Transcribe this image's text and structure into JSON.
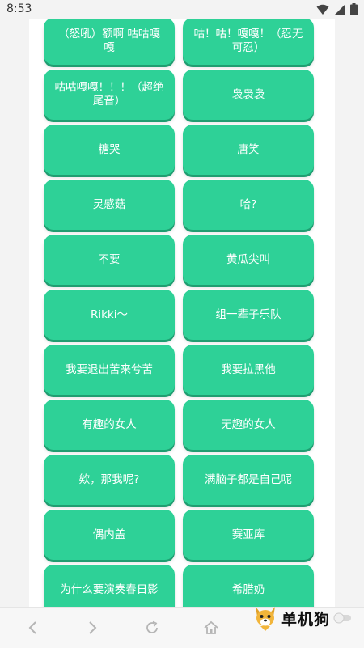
{
  "status_bar": {
    "time": "8:53"
  },
  "sound_buttons": [
    "（怒吼）额啊 咕咕嘎嘎",
    "咕！咕！嘎嘎！（忍无可忍）",
    "咕咕嘎嘎！！！（超绝尾音）",
    "袅袅袅",
    "糖哭",
    "唐笑",
    "灵感菇",
    "哈?",
    "不要",
    "黄瓜尖叫",
    "Rikki～",
    "组一辈子乐队",
    "我要退出苦来兮苦",
    "我要拉黑他",
    "有趣的女人",
    "无趣的女人",
    "欸，那我呢?",
    "满脑子都是自己呢",
    "偶内盖",
    "赛亚库",
    "为什么要演奏春日影",
    "希腊奶"
  ],
  "bottom_nav": {
    "back_icon": "chevron-left-icon",
    "forward_icon": "chevron-right-icon",
    "refresh_icon": "refresh-icon",
    "home_icon": "home-icon"
  },
  "watermark": {
    "text": "单机狗",
    "icon": "dog-mascot-icon"
  },
  "colors": {
    "button": "#2ed197",
    "button_shadow": "#1f9e71",
    "page_bg": "#ffffff"
  }
}
